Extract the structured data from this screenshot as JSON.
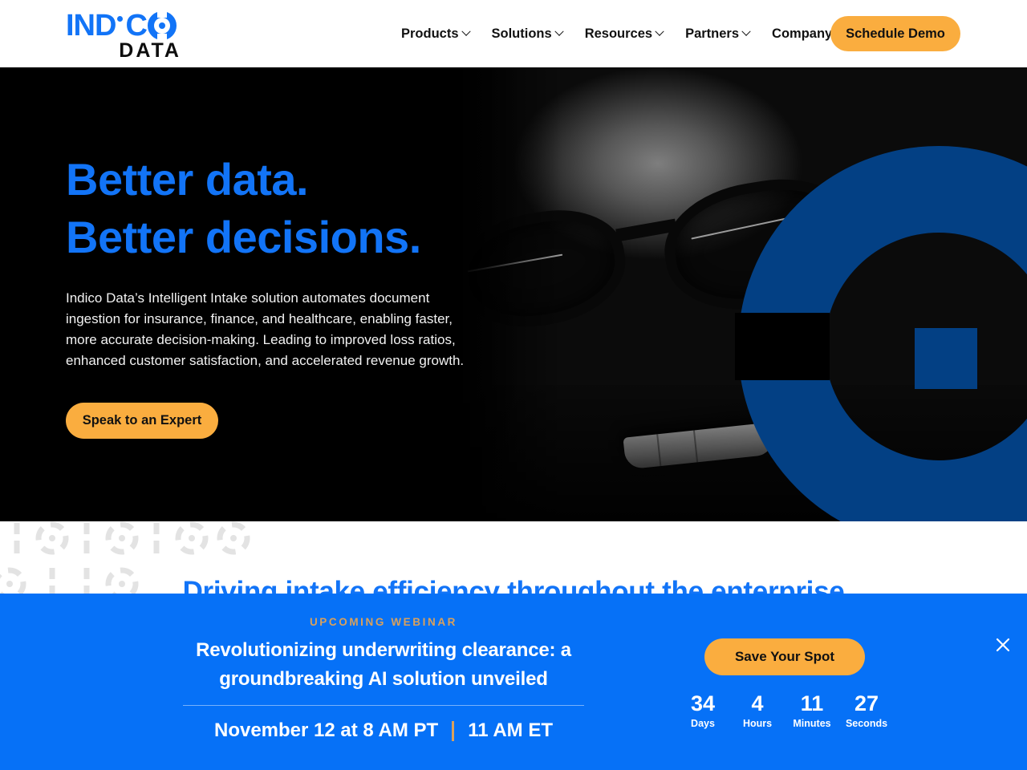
{
  "header": {
    "logo": {
      "word_part1": "IND",
      "word_part2": "C",
      "subtitle": "DATA",
      "dot_icon": "i-dot-icon",
      "target_icon": "target-o-icon",
      "color": "#1274f7"
    },
    "nav_items": [
      {
        "label": "Products",
        "has_dropdown": true
      },
      {
        "label": "Solutions",
        "has_dropdown": true
      },
      {
        "label": "Resources",
        "has_dropdown": true
      },
      {
        "label": "Partners",
        "has_dropdown": true
      },
      {
        "label": "Company",
        "has_dropdown": true
      }
    ],
    "cta": {
      "label": "Schedule Demo",
      "color": "#faad3f"
    }
  },
  "hero": {
    "heading_line1": "Better data.",
    "heading_line2": "Better decisions.",
    "heading_color": "#1274f7",
    "paragraph": "Indico Data’s Intelligent Intake solution automates document ingestion for insurance, finance, and healthcare, enabling faster, more accurate decision-making. Leading to improved loss ratios, enhanced customer satisfaction, and accelerated revenue growth.",
    "cta": {
      "label": "Speak to an Expert",
      "color": "#faad3f"
    },
    "graphic": {
      "name": "indico-c-mark",
      "color": "#034084"
    },
    "background_color": "#000000"
  },
  "section": {
    "title": "Driving intake efficiency throughout the enterprise",
    "title_color": "#1274f7",
    "decoration": "binary-pattern-1-0-1-0-0"
  },
  "banner": {
    "kicker": "UPCOMING WEBINAR",
    "kicker_color": "#d9a15c",
    "title": "Revolutionizing underwriting clearance: a groundbreaking AI solution unveiled",
    "date_primary": "November 12 at 8 AM PT",
    "date_separator": "|",
    "date_secondary": "11 AM ET",
    "cta": {
      "label": "Save Your Spot",
      "color": "#faad3f"
    },
    "background_color": "#0671f7",
    "close_icon": "close-icon",
    "countdown": [
      {
        "value": "34",
        "label": "Days"
      },
      {
        "value": "4",
        "label": "Hours"
      },
      {
        "value": "11",
        "label": "Minutes"
      },
      {
        "value": "27",
        "label": "Seconds"
      }
    ]
  }
}
